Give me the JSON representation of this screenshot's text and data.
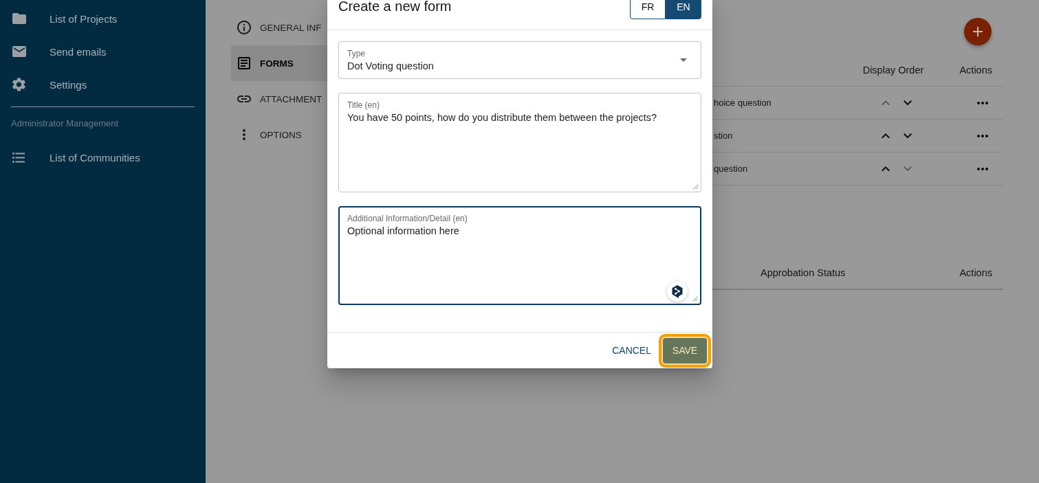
{
  "sidebar": {
    "items": [
      {
        "label": "List of Projects"
      },
      {
        "label": "Send emails"
      },
      {
        "label": "Settings"
      }
    ],
    "section_title": "Administrator Management",
    "admin_items": [
      {
        "label": "List of Communities"
      }
    ]
  },
  "project_nav": {
    "items": [
      {
        "label": "GENERAL INF",
        "selected": false
      },
      {
        "label": "FORMS",
        "selected": true
      },
      {
        "label": "ATTACHMENT",
        "selected": false
      },
      {
        "label": "OPTIONS",
        "selected": false
      }
    ]
  },
  "forms_table": {
    "columns": [
      "Display Order",
      "Actions"
    ],
    "rows": [
      {
        "title": "hoice question",
        "up_disabled": true,
        "down_disabled": false
      },
      {
        "title": "stion",
        "up_disabled": false,
        "down_disabled": false
      },
      {
        "title": "question",
        "up_disabled": false,
        "down_disabled": true
      }
    ]
  },
  "approbation_table": {
    "columns": [
      "Approbation Status",
      "Actions"
    ]
  },
  "dialog": {
    "title": "Create a new form",
    "languages": [
      {
        "label": "FR",
        "selected": false
      },
      {
        "label": "EN",
        "selected": true
      }
    ],
    "fields": [
      {
        "kind": "select",
        "label": "Type",
        "value": "Dot Voting question",
        "focused": false
      },
      {
        "kind": "textarea",
        "label": "Title (en)",
        "value": "You have 50 points, how do you distribute them between the projects?",
        "focused": false
      },
      {
        "kind": "textarea",
        "label": "Additional Information/Detail (en)",
        "value": "Optional information here",
        "focused": true
      }
    ],
    "cancel_button": {
      "label": "CANCEL"
    },
    "save_button": {
      "label": "SAVE",
      "focused": true
    }
  }
}
